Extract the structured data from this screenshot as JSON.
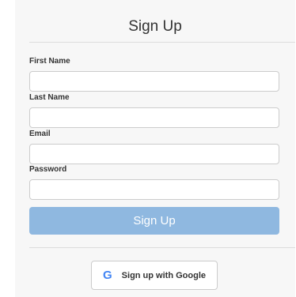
{
  "form": {
    "title": "Sign Up",
    "fields": [
      {
        "label": "First Name",
        "value": ""
      },
      {
        "label": "Last Name",
        "value": ""
      },
      {
        "label": "Email",
        "value": ""
      },
      {
        "label": "Password",
        "value": ""
      }
    ],
    "submit_label": "Sign Up",
    "google_label": "Sign up with Google",
    "google_icon": "google-icon"
  },
  "colors": {
    "submit_bg": "#8fb8e0",
    "google_icon": "#4285f4",
    "card_bg": "#f7f7f7"
  }
}
